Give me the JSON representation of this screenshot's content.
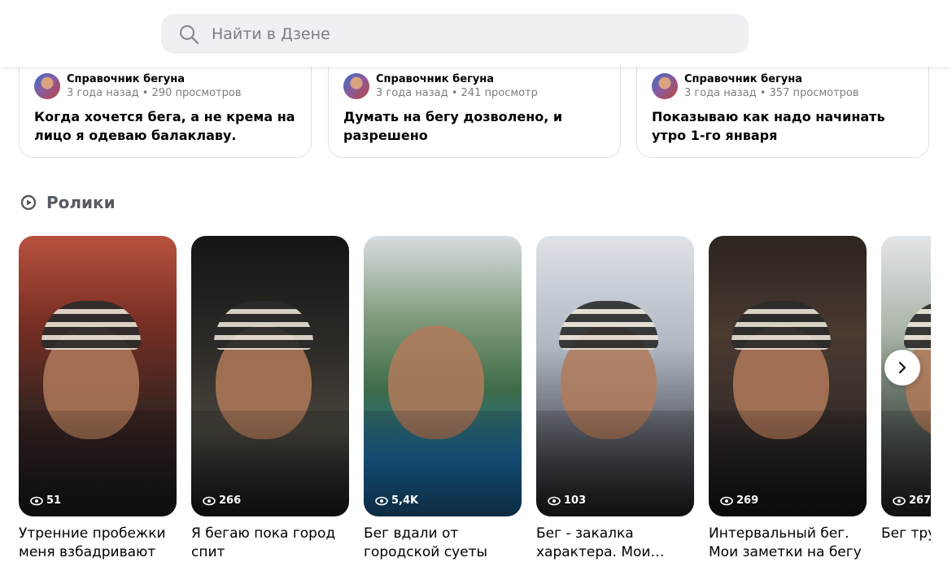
{
  "search": {
    "placeholder": "Найти в Дзене"
  },
  "articles": [
    {
      "author": "Справочник бегуна",
      "meta": "3 года назад • 290 просмотров",
      "title": "Когда хочется бега, а не крема на лицо я одеваю балаклаву."
    },
    {
      "author": "Справочник бегуна",
      "meta": "3 года назад • 241 просмотр",
      "title": "Думать на бегу дозволено, и разрешено"
    },
    {
      "author": "Справочник бегуна",
      "meta": "3 года назад • 357 просмотров",
      "title": "Показываю как надо начинать утро 1-го января"
    }
  ],
  "videos_section": {
    "title": "Ролики",
    "icon": "play-circle-icon",
    "items": [
      {
        "views": "51",
        "title": "Утренние пробежки меня взбадривают"
      },
      {
        "views": "266",
        "title": "Я бегаю пока город спит"
      },
      {
        "views": "5,4K",
        "title": "Бег вдали от городской суеты"
      },
      {
        "views": "103",
        "title": "Бег - закалка характера. Мои…"
      },
      {
        "views": "269",
        "title": "Интервальный бег. Мои заметки на бегу"
      },
      {
        "views": "267",
        "title": "Бег тру разгово"
      }
    ]
  },
  "colors": {
    "search_bg": "#eef0f3",
    "card_border": "#dfe1e5",
    "meta_text": "#7b7e84",
    "section_title": "#555a61"
  }
}
